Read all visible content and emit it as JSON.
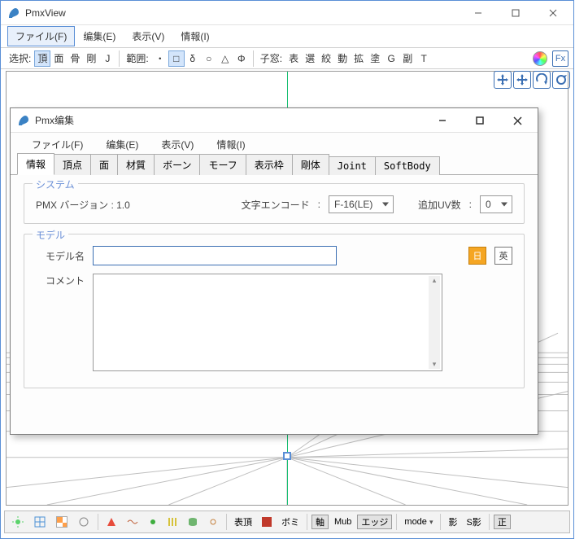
{
  "main_window": {
    "title": "PmxView",
    "menubar": {
      "file": "ファイル(F)",
      "edit": "编集(E)",
      "view": "表示(V)",
      "info": "情報(I)"
    },
    "toolbar": {
      "select_label": "选択:",
      "sel_btns": [
        "頂",
        "面",
        "骨",
        "剛",
        "J"
      ],
      "range_label": "範囲:",
      "range_btns": [
        "・",
        "□",
        "δ",
        "○",
        "△",
        "Φ"
      ],
      "child_label": "子窓:",
      "child_btns": [
        "表",
        "選",
        "絞",
        "動",
        "拡",
        "塗",
        "G",
        "副",
        "T"
      ]
    },
    "gizmos": [
      "move",
      "arrows",
      "rotate-y",
      "rotate"
    ],
    "bottombar": {
      "surface": "表頂",
      "bomi": "ボミ",
      "axis": "軸",
      "mub": "Mub",
      "edge": "エッジ",
      "mode": "mode",
      "shadow": "影",
      "sshadow": "S影",
      "ortho": "正"
    }
  },
  "dialog": {
    "title": "Pmx编集",
    "menubar": {
      "file": "ファイル(F)",
      "edit": "编集(E)",
      "view": "表示(V)",
      "info": "情報(I)"
    },
    "tabs": [
      "情報",
      "頂点",
      "面",
      "材質",
      "ボーン",
      "モーフ",
      "表示枠",
      "剛体",
      "Joint",
      "SoftBody"
    ],
    "system": {
      "legend": "システム",
      "version_label": "PMX バージョン",
      "version_value": "1.0",
      "encoding_label": "文字エンコード",
      "encoding_value": "F-16(LE)",
      "uv_label": "追加UV数",
      "uv_value": "0"
    },
    "model": {
      "legend": "モデル",
      "name_label": "モデル名",
      "name_value": "",
      "lang_jp": "日",
      "lang_en": "英",
      "comment_label": "コメント",
      "comment_value": ""
    }
  }
}
